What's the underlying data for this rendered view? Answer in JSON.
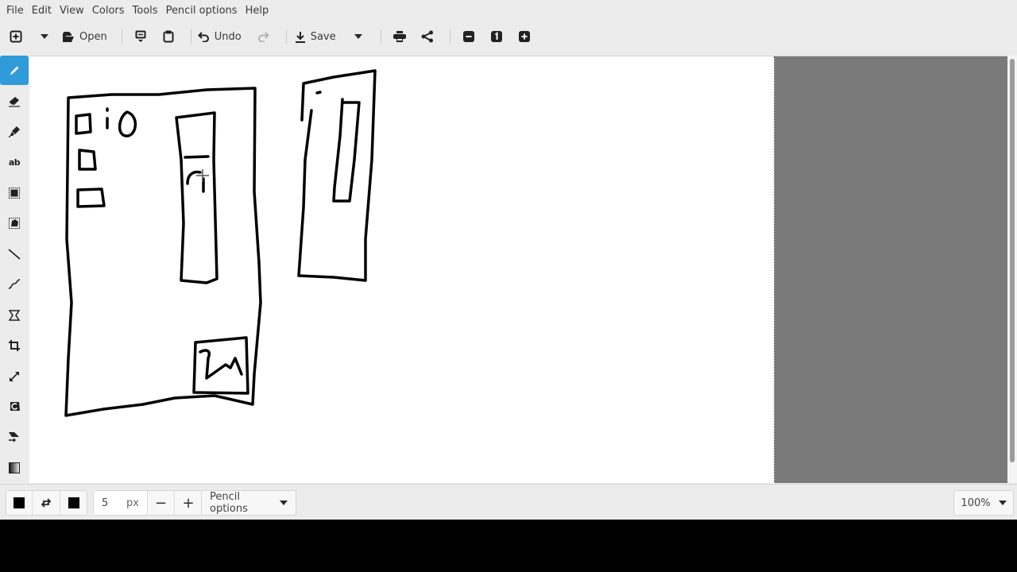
{
  "menubar": {
    "items": [
      {
        "label": "File"
      },
      {
        "label": "Edit"
      },
      {
        "label": "View"
      },
      {
        "label": "Colors"
      },
      {
        "label": "Tools"
      },
      {
        "label": "Pencil options"
      },
      {
        "label": "Help"
      }
    ]
  },
  "toolbar": {
    "new_icon": "new-image-icon",
    "open_label": "Open",
    "undo_label": "Undo",
    "save_label": "Save",
    "zoom_in_hint": "+",
    "zoom_1_hint": "1",
    "zoom_out_hint": "-"
  },
  "tools": {
    "active": "pencil",
    "items": [
      {
        "id": "pencil",
        "icon": "pencil-icon"
      },
      {
        "id": "eraser",
        "icon": "eraser-icon"
      },
      {
        "id": "highlighter",
        "icon": "highlighter-icon"
      },
      {
        "id": "text",
        "icon": "text-icon",
        "glyph": "ab"
      },
      {
        "id": "rect-select",
        "icon": "rectangle-selection-icon"
      },
      {
        "id": "free-select",
        "icon": "free-selection-icon"
      },
      {
        "id": "line",
        "icon": "line-icon"
      },
      {
        "id": "curve",
        "icon": "curve-icon"
      },
      {
        "id": "shape",
        "icon": "shape-icon"
      },
      {
        "id": "crop",
        "icon": "crop-icon"
      },
      {
        "id": "scale",
        "icon": "scale-icon"
      },
      {
        "id": "rotate",
        "icon": "rotate-icon"
      },
      {
        "id": "skew",
        "icon": "skew-icon"
      },
      {
        "id": "filters",
        "icon": "filters-icon"
      }
    ]
  },
  "bottombar": {
    "primary_color": "#000000",
    "secondary_color": "#000000",
    "size_value": "5",
    "size_unit": "px",
    "minus": "−",
    "plus": "+",
    "options_label": "Pencil options",
    "zoom_value": "100%"
  },
  "colors": {
    "accent": "#2f9bd9",
    "canvas_bg": "#7a7a7a",
    "paper": "#ffffff"
  }
}
